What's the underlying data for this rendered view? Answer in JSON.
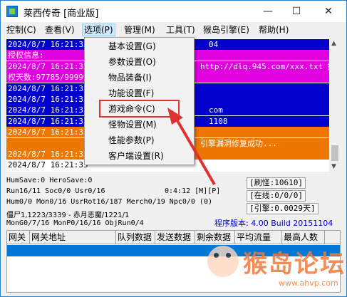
{
  "window": {
    "title": "莱西传奇 [商业版]",
    "min_label": "—",
    "max_label": "☐",
    "close_label": "✕"
  },
  "menu": [
    {
      "label": "控制(C)"
    },
    {
      "label": "查看(V)"
    },
    {
      "label": "选项(P)",
      "active": true
    },
    {
      "label": "管理(M)"
    },
    {
      "label": "工具(T)"
    },
    {
      "label": "猴岛引擎(E)"
    },
    {
      "label": "帮助(H)"
    }
  ],
  "dropdown": {
    "items": [
      {
        "label": "基本设置(G)"
      },
      {
        "label": "参数设置(O)"
      },
      {
        "label": "物品装备(I)"
      },
      {
        "label": "功能设置(F)"
      },
      {
        "label": "游戏命令(C)",
        "highlighted": true
      },
      {
        "label": "怪物设置(M)"
      },
      {
        "label": "性能参数(P)"
      },
      {
        "label": "客户端设置(R)"
      }
    ]
  },
  "log": {
    "rows": [
      {
        "text": "2024/8/7 16:21:35",
        "tail": "04",
        "bg": "#0000cc",
        "fg": "#ffffff"
      },
      {
        "text": "授权信息:",
        "bg": "#e000e0",
        "fg": "#ffffff"
      },
      {
        "text": "2024/8/7 16:21:35",
        "tail": "http://dlq.945.com/xxx.txt 授",
        "bg": "#e000e0",
        "fg": "#ffffff"
      },
      {
        "text": "权天数:97785/99999",
        "bg": "#e000e0",
        "fg": "#ffffff"
      },
      {
        "text": "2024/8/7 16:21:35",
        "bg": "#0000cc",
        "fg": "#ffffff"
      },
      {
        "text": "2024/8/7 16:21:35",
        "bg": "#0000cc",
        "fg": "#ffffff"
      },
      {
        "text": "2024/8/7 16:21:35",
        "tail": "com",
        "bg": "#0000cc",
        "fg": "#ffffff"
      },
      {
        "text": "2024/8/7 16:21:35",
        "tail": "1108",
        "bg": "#0000cc",
        "fg": "#ffffff"
      },
      {
        "text": "2024/8/7 16:21:35",
        "bg": "#ee7700",
        "fg": "#ffffff"
      },
      {
        "text": "",
        "tail": "引擎漏洞修复成功...",
        "bg": "#ee7700",
        "fg": "#ffffff"
      },
      {
        "text": "2024/8/7 16:21:35",
        "bg": "#ee7700",
        "fg": "#ffffff"
      },
      {
        "text": "2024/8/7 16:21:35",
        "bg": "#ffffff",
        "fg": "#000000"
      }
    ]
  },
  "status": {
    "line1": "HumSave:0 HeroSave:0",
    "line2": "Run16/11 Soc0/0 Usr0/16",
    "line2_time": "0:4:12 [M][P]",
    "line3": "Hum0/0 Mon0/16 UsrRot16/187 Merch0/19 Npc0/0 (0)",
    "line4": "僵尸1,1223/3339 - 赤月恶魔/1221/1",
    "line5": "MonG0/7/16 MonP0/16/16 ObjRun0/4",
    "refresh": "[刷怪:10610]",
    "online": "[在线:0/0/0]",
    "engine": "[引擎:0.0029天]",
    "version": "程序版本: 4.00 Build 20151104"
  },
  "grid": {
    "columns": [
      "网关",
      "网关地址",
      "队列数据",
      "发送数据",
      "剩余数据",
      "平均流量",
      "最高人数"
    ]
  },
  "watermark": {
    "text": "猴岛论坛",
    "url": "www.ahvp.com"
  },
  "colors": {
    "annotation_red": "#e03030",
    "selection_blue": "#0078d7"
  }
}
